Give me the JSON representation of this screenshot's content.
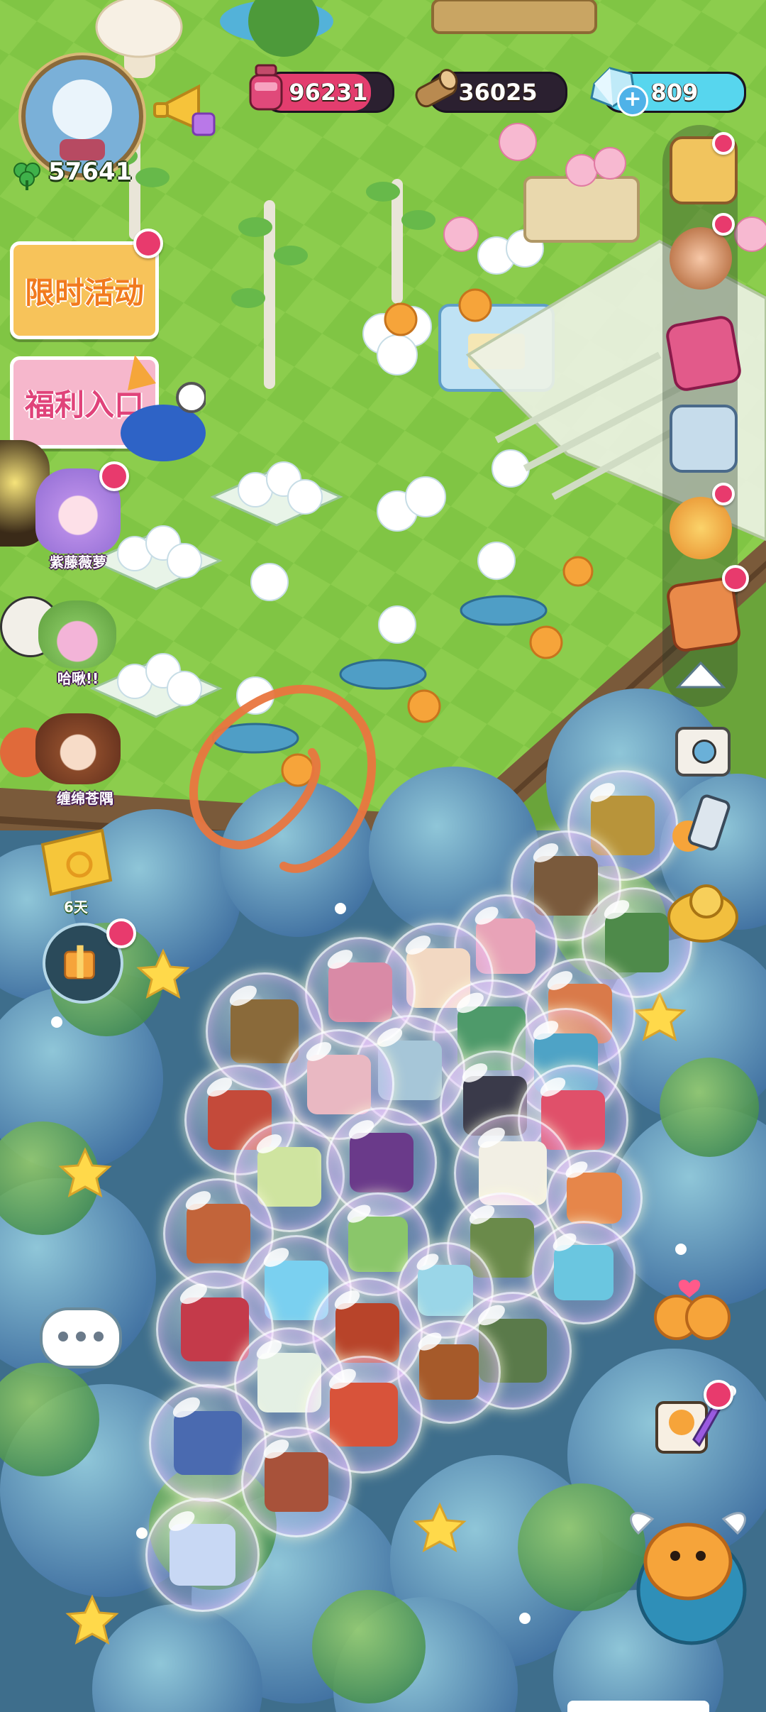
{
  "player": {
    "clover_count": "57641"
  },
  "resources": {
    "gems_value": "96231",
    "wood_value": "36025",
    "crystal_value": "809"
  },
  "left_menu": {
    "event_banner": "限时活动",
    "welfare_banner": "福利入口",
    "npc1_name": "紫藤薇萝",
    "npc2_name": "哈啾!!",
    "npc3_name": "缠绵苍隅",
    "chest_days": "6天"
  },
  "colors": {
    "grass": "#7cc241",
    "forest": "#4f8fb0",
    "badge": "#e83a6d",
    "gem_bar": "#e33d6e",
    "crystal_bar": "#57d6ee",
    "banner_orange": "#f7c35a",
    "banner_pink": "#f6b7cc",
    "circle_annotation": "#e9763f"
  },
  "icons": {
    "right_rail": [
      "chest-icon",
      "animal-friends-icon",
      "book-icon",
      "speaker-icon",
      "chick-gift-icon",
      "recipe-book-icon",
      "arrow-up-icon"
    ],
    "right_lower": [
      "camera-icon",
      "phone-icon",
      "gold-lion-icon",
      "chicks-love-icon",
      "portrait-quill-icon",
      "winged-chick-icon"
    ]
  }
}
